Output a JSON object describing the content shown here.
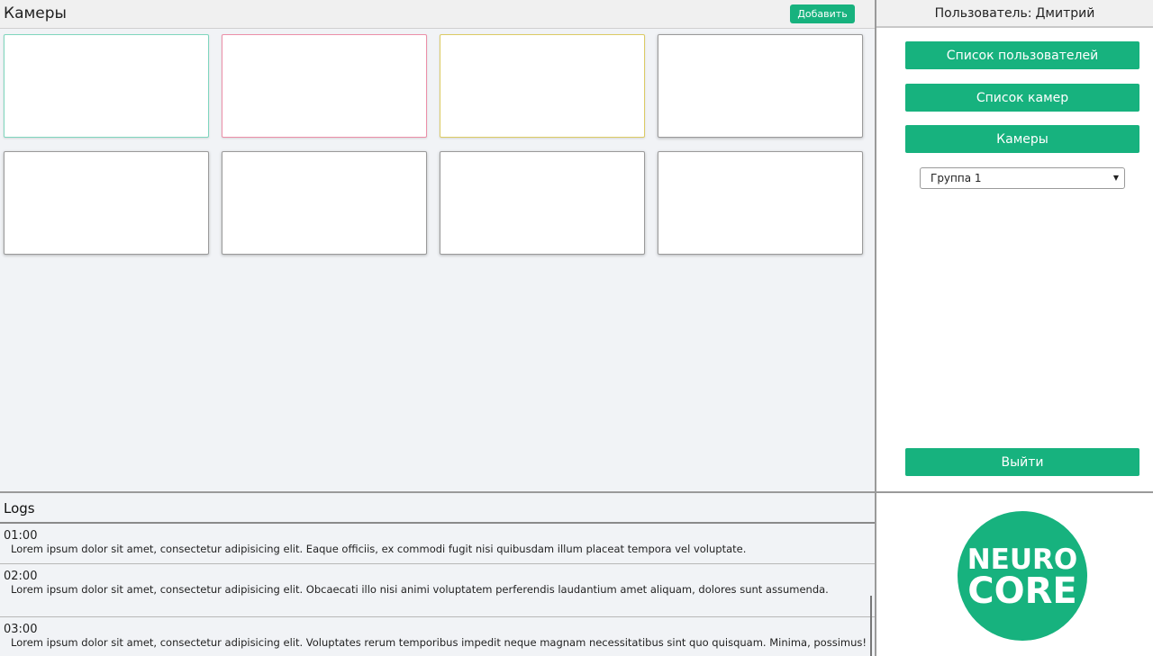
{
  "main": {
    "title": "Камеры",
    "add_label": "Добавить"
  },
  "cameras": [
    {
      "status_color": "#7fd6be"
    },
    {
      "status_color": "#ec8fa8"
    },
    {
      "status_color": "#dccb64"
    },
    {
      "status_color": "#9a9a9a"
    },
    {
      "status_color": "#9a9a9a"
    },
    {
      "status_color": "#9a9a9a"
    },
    {
      "status_color": "#9a9a9a"
    },
    {
      "status_color": "#9a9a9a"
    }
  ],
  "sidebar": {
    "user_label": "Пользователь:",
    "user_name": "Дмитрий",
    "buttons": [
      {
        "label": "Список пользователей"
      },
      {
        "label": "Список камер"
      },
      {
        "label": "Камеры"
      }
    ],
    "group_select": {
      "value": "Группа 1"
    },
    "logout_label": "Выйти"
  },
  "logs": {
    "title": "Logs",
    "entries": [
      {
        "time": "01:00",
        "text": "Lorem ipsum dolor sit amet, consectetur adipisicing elit. Eaque officiis, ex commodi fugit nisi quibusdam illum placeat tempora vel voluptate."
      },
      {
        "time": "02:00",
        "text": "Lorem ipsum dolor sit amet, consectetur adipisicing elit. Obcaecati illo nisi animi voluptatem perferendis laudantium amet aliquam, dolores sunt assumenda."
      },
      {
        "time": "03:00",
        "text": "Lorem ipsum dolor sit amet, consectetur adipisicing elit. Voluptates rerum temporibus impedit neque magnam necessitatibus sint quo quisquam. Minima, possimus!"
      }
    ]
  },
  "logo": {
    "line1": "NEURO",
    "line2": "CORE"
  },
  "colors": {
    "accent": "#17b27e"
  }
}
